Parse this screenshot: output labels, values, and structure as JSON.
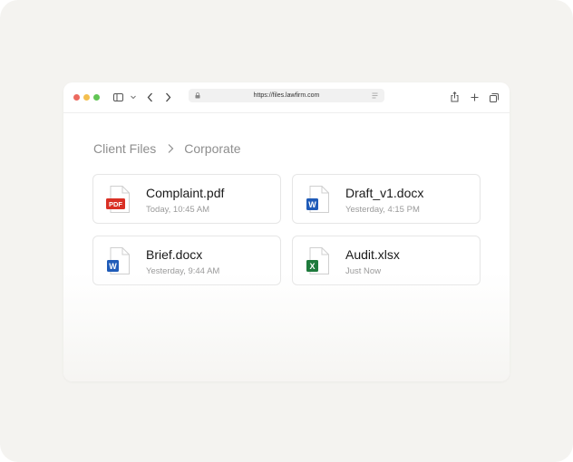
{
  "browser": {
    "url": "https://files.lawfirm.com",
    "traffic_lights": {
      "close": "#ec6a5f",
      "minimize": "#f4bf4f",
      "zoom": "#61c554"
    }
  },
  "breadcrumb": {
    "items": [
      "Client Files",
      "Corporate"
    ]
  },
  "files": [
    {
      "name": "Complaint.pdf",
      "modified": "Today, 10:45 AM",
      "type": "pdf",
      "badge": "PDF",
      "badge_color": "#d93025"
    },
    {
      "name": "Draft_v1.docx",
      "modified": "Yesterday, 4:15 PM",
      "type": "docx",
      "badge": "W",
      "badge_color": "#1f5bb8"
    },
    {
      "name": "Brief.docx",
      "modified": "Yesterday, 9:44 AM",
      "type": "docx",
      "badge": "W",
      "badge_color": "#1f5bb8"
    },
    {
      "name": "Audit.xlsx",
      "modified": "Just Now",
      "type": "xlsx",
      "badge": "X",
      "badge_color": "#1e7a3c"
    }
  ],
  "icons": {
    "sidebar": "sidebar-toggle-icon",
    "back": "chevron-left-icon",
    "forward": "chevron-right-icon",
    "lock": "lock-icon",
    "reader": "reader-icon",
    "share": "share-icon",
    "new_tab": "plus-icon",
    "tabs": "tabs-icon"
  }
}
